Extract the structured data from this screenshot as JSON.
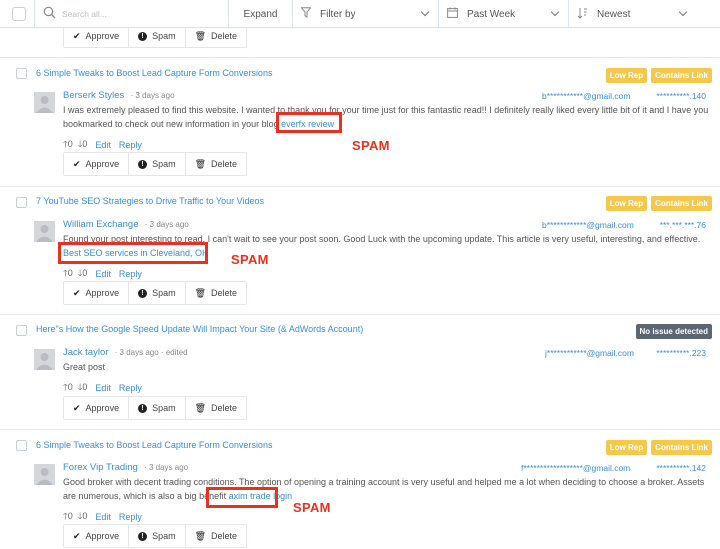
{
  "toolbar": {
    "search_placeholder": "Search all...",
    "expand_label": "Expand",
    "filter_label": "Filter by",
    "period_label": "Past Week",
    "sort_label": "Newest"
  },
  "actions": {
    "approve": "Approve",
    "spam": "Spam",
    "delete": "Delete"
  },
  "meta": {
    "up_count": "0",
    "down_count": "0",
    "edit": "Edit",
    "reply": "Reply"
  },
  "annotation_label": "SPAM",
  "comments": [
    {
      "post_title": "6 Simple Tweaks to Boost Lead Capture Form Conversions",
      "badges": [
        "Low Rep",
        "Contains Link"
      ],
      "author": "Berserk Styles",
      "time": "3 days ago",
      "edited": "",
      "email": "b***********@gmail.com",
      "ip": "**********.140",
      "text": "I was extremely pleased to find this website. I wanted to thank you for your time just for this fantastic read!! I definitely really liked every little bit of it and I have you bookmarked to check out new information in your blog",
      "link_text": "everfx review"
    },
    {
      "post_title": "7 YouTube SEO Strategies to Drive Traffic to Your Videos",
      "badges": [
        "Low Rep",
        "Contains Link"
      ],
      "author": "William Exchange",
      "time": "3 days ago",
      "edited": "",
      "email": "b************@gmail.com",
      "ip": "***.***.***.76",
      "text": "Found your post interesting to read. I can't wait to see your post soon. Good Luck with the upcoming update. This article is very useful, interesting, and effective.",
      "link_text": "Best SEO services in Cleveland, OH"
    },
    {
      "post_title": "Here\"s How the Google Speed Update Will Impact Your Site (& AdWords Account)",
      "badges": [
        "No issue detected"
      ],
      "author": "Jack taylor",
      "time": "3 days ago",
      "edited": "edited",
      "email": "j************@gmail.com",
      "ip": "**********.223",
      "text": "Great post",
      "link_text": ""
    },
    {
      "post_title": "6 Simple Tweaks to Boost Lead Capture Form Conversions",
      "badges": [
        "Low Rep",
        "Contains Link"
      ],
      "author": "Forex Vip Trading",
      "time": "3 days ago",
      "edited": "",
      "email": "f******************@gmail.com",
      "ip": "**********.142",
      "text": "Good broker with decent trading conditions. The option of opening a training account is very useful and helped me a lot when deciding to choose a broker. Assets are numerous, which is also a big benefit",
      "link_text": "axim trade login"
    }
  ],
  "colors": {
    "accent": "#3a8fd1",
    "annotation": "#e8321d",
    "badge_warning": "#f5c84a",
    "badge_neutral": "#5c6670"
  }
}
